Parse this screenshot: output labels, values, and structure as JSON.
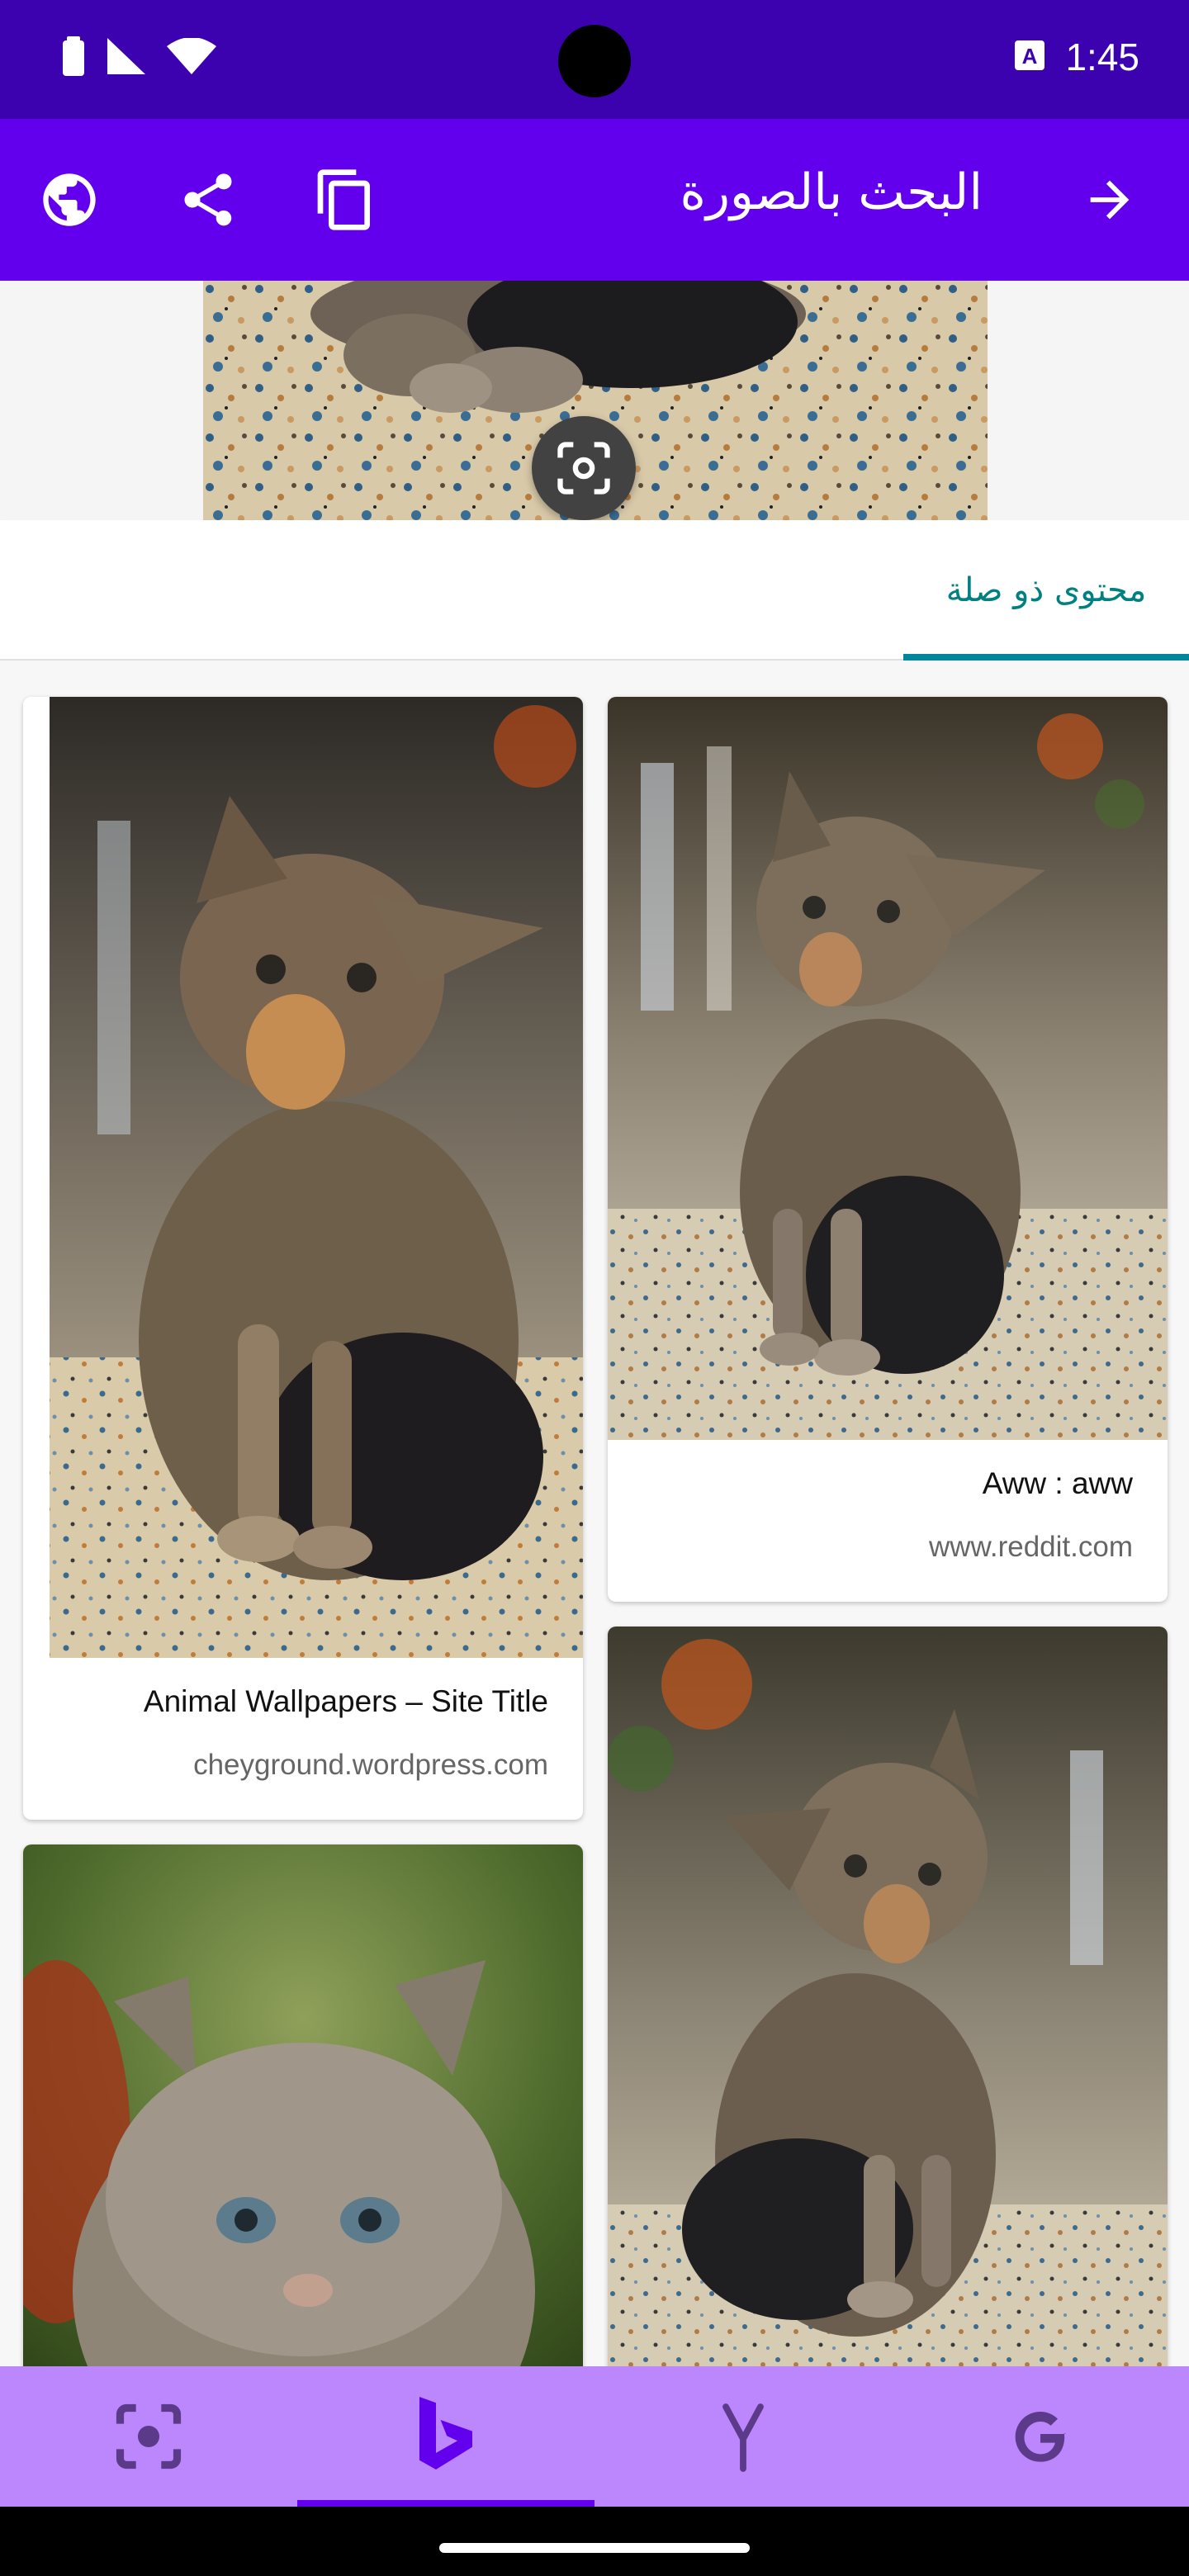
{
  "status_bar": {
    "time": "1:45",
    "icons": [
      "battery-icon",
      "signal-icon",
      "wifi-icon",
      "keyboard-a-icon"
    ]
  },
  "app_bar": {
    "title": "البحث بالصورة",
    "icons": [
      "globe-icon",
      "share-icon",
      "copy-icon",
      "arrow-forward-icon"
    ],
    "color": "#6200ee"
  },
  "tabs": {
    "related_label": "محتوى ذو صلة",
    "accent": "#00869a"
  },
  "results": [
    {
      "title": "Aww : aww",
      "source": "www.reddit.com"
    },
    {
      "title": "Animal Wallpapers – Site Title",
      "source": "cheyground.wordpress.com"
    }
  ],
  "bottom_nav": {
    "items": [
      "lens-icon",
      "bing-icon",
      "yandex-icon",
      "google-icon"
    ],
    "selected": "bing-icon",
    "color": "#bc86fc"
  }
}
